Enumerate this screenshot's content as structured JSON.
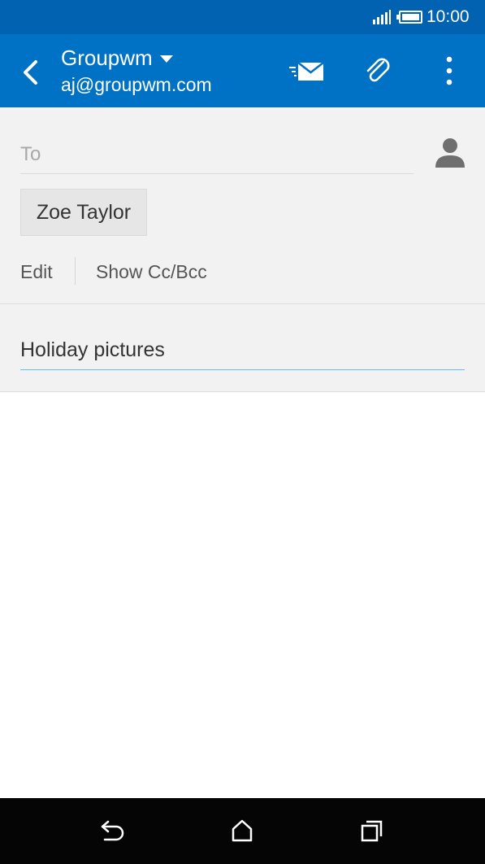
{
  "status_bar": {
    "time": "10:00",
    "icons": [
      "signal-icon",
      "battery-icon"
    ]
  },
  "app_bar": {
    "account_name": "Groupwm",
    "account_email": "aj@groupwm.com",
    "icons": [
      "back-arrow-icon",
      "chevron-down-icon",
      "send-mail-icon",
      "paperclip-icon",
      "more-vert-icon"
    ]
  },
  "compose": {
    "to_placeholder": "To",
    "recipients": [
      "Zoe Taylor"
    ],
    "edit_label": "Edit",
    "show_cc_bcc_label": "Show Cc/Bcc",
    "subject": "Holiday pictures",
    "body": ""
  },
  "navigation": {
    "icons": [
      "nav-back-icon",
      "nav-home-icon",
      "nav-recent-apps-icon"
    ]
  },
  "colors": {
    "status_bar": "#0062b1",
    "app_bar": "#0072c6",
    "header_background": "#f2f2f2",
    "subject_underline": "#5cc1e6",
    "nav_bar": "#050505"
  }
}
